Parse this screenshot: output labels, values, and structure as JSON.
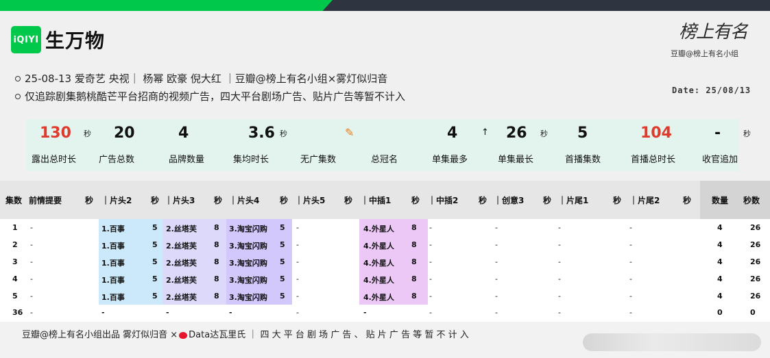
{
  "header": {
    "logo_text": "iQIYI",
    "show_title": "生万物",
    "signature_text": "榜上有名",
    "signature_sub": "豆瓣@榜上有名小组",
    "date": "Date: 25/08/13",
    "brand_color": "#00c84b"
  },
  "info": {
    "line1": "25-08-13 爱奇艺 央视｜ 杨幂 欧豪 倪大红 ｜豆瓣@榜上有名小组×雾灯似归音",
    "line2": "仅追踪剧集鹅桃酷芒平台招商的视频广告，四大平台剧场广告、贴片广告等暂不计入"
  },
  "stats": [
    {
      "value": "130",
      "unit": "秒",
      "label": "露出总时长",
      "red": true
    },
    {
      "value": "20",
      "unit": "",
      "label": "广告总数",
      "red": false
    },
    {
      "value": "4",
      "unit": "",
      "label": "品牌数量",
      "red": false
    },
    {
      "value": "3.6",
      "unit": "秒",
      "label": "集均时长",
      "red": false
    },
    {
      "value": "",
      "unit": "",
      "label": "无广集数",
      "red": false
    },
    {
      "value": "",
      "unit": "",
      "label": "总冠名",
      "red": false
    },
    {
      "value": "4",
      "unit": "",
      "label": "单集最多",
      "red": false
    },
    {
      "value": "26",
      "unit": "秒",
      "label": "单集最长",
      "red": false
    },
    {
      "value": "5",
      "unit": "",
      "label": "首播集数",
      "red": false
    },
    {
      "value": "104",
      "unit": "",
      "label": "首播总时长",
      "red": true
    },
    {
      "value": "-",
      "unit": "秒",
      "label": "收官追加",
      "red": false
    }
  ],
  "table": {
    "headers": {
      "ep": "集数",
      "recap": "前情提要",
      "s0": "秒",
      "h2": "｜片头2",
      "s1": "秒",
      "h3": "｜片头3",
      "s2": "秒",
      "h4": "｜片头4",
      "s3": "秒",
      "h5": "｜片头5",
      "s4": "秒",
      "m1": "｜中插1",
      "s5": "秒",
      "m2": "｜中插2",
      "s6": "秒",
      "c3": "｜创意3",
      "s7": "秒",
      "e1": "｜片尾1",
      "s8": "秒",
      "e2": "｜片尾2",
      "s9": "秒",
      "count": "数量",
      "secs": "秒数"
    },
    "rows": [
      {
        "ep": "1",
        "recap": "-",
        "h2": "1.百事",
        "h2s": "5",
        "h3": "2.丝塔芙",
        "h3s": "8",
        "h4": "3.淘宝闪购",
        "h4s": "5",
        "h5": "-",
        "m1": "4.外星人",
        "m1s": "8",
        "m2": "-",
        "c3": "-",
        "e1": "-",
        "e2": "-",
        "count": "4",
        "secs": "26"
      },
      {
        "ep": "2",
        "recap": "-",
        "h2": "1.百事",
        "h2s": "5",
        "h3": "2.丝塔芙",
        "h3s": "8",
        "h4": "3.淘宝闪购",
        "h4s": "5",
        "h5": "-",
        "m1": "4.外星人",
        "m1s": "8",
        "m2": "-",
        "c3": "-",
        "e1": "-",
        "e2": "-",
        "count": "4",
        "secs": "26"
      },
      {
        "ep": "3",
        "recap": "-",
        "h2": "1.百事",
        "h2s": "5",
        "h3": "2.丝塔芙",
        "h3s": "8",
        "h4": "3.淘宝闪购",
        "h4s": "5",
        "h5": "-",
        "m1": "4.外星人",
        "m1s": "8",
        "m2": "-",
        "c3": "-",
        "e1": "-",
        "e2": "-",
        "count": "4",
        "secs": "26"
      },
      {
        "ep": "4",
        "recap": "-",
        "h2": "1.百事",
        "h2s": "5",
        "h3": "2.丝塔芙",
        "h3s": "8",
        "h4": "3.淘宝闪购",
        "h4s": "5",
        "h5": "-",
        "m1": "4.外星人",
        "m1s": "8",
        "m2": "-",
        "c3": "-",
        "e1": "-",
        "e2": "-",
        "count": "4",
        "secs": "26"
      },
      {
        "ep": "5",
        "recap": "-",
        "h2": "1.百事",
        "h2s": "5",
        "h3": "2.丝塔芙",
        "h3s": "8",
        "h4": "3.淘宝闪购",
        "h4s": "5",
        "h5": "-",
        "m1": "4.外星人",
        "m1s": "8",
        "m2": "-",
        "c3": "-",
        "e1": "-",
        "e2": "-",
        "count": "4",
        "secs": "26"
      },
      {
        "ep": "36",
        "recap": "-",
        "h2": "-",
        "h2s": "",
        "h3": "-",
        "h3s": "",
        "h4": "-",
        "h4s": "",
        "h5": "-",
        "m1": "-",
        "m1s": "",
        "m2": "-",
        "c3": "-",
        "e1": "-",
        "e2": "-",
        "count": "0",
        "secs": "0"
      }
    ]
  },
  "footer": {
    "part1": "豆瓣@榜上有名小组出品  雾灯似归音 ×",
    "part2": "Data达瓦里氏 ｜ 四 大 平 台 剧 场 广 告 、 贴 片 广 告 等 暂 不 计 入"
  }
}
